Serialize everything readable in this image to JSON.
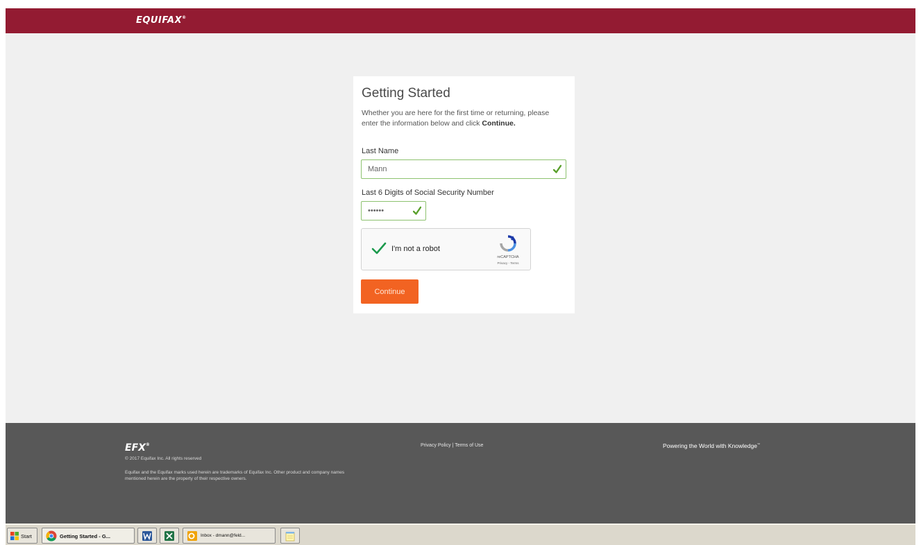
{
  "header": {
    "logo": "EQUIFAX",
    "logo_mark": "®"
  },
  "card": {
    "title": "Getting Started",
    "intro_text": "Whether you are here for the first time or returning, please enter the information below and click",
    "intro_bold": "Continue.",
    "last_name_label": "Last Name",
    "last_name_value": "Mann",
    "ssn_label": "Last 6 Digits of Social Security Number",
    "ssn_value": "••••••",
    "continue_label": "Continue"
  },
  "captcha": {
    "label": "I'm not a robot",
    "brand": "reCAPTCHA",
    "links": "Privacy - Terms"
  },
  "footer": {
    "logo": "EFX",
    "logo_mark": "®",
    "copyright": "© 2017 Equifax Inc. All rights reserved",
    "trademark": "Equifax and the Equifax marks used herein are trademarks of Equifax Inc. Other product and company names mentioned herein are the property of their respective owners.",
    "privacy_link": "Privacy Policy",
    "separator": "|",
    "terms_link": "Terms of Use",
    "tagline": "Powering the World with Knowledge",
    "tagline_mark": "™"
  },
  "taskbar": {
    "start_label": "Start",
    "chrome_label": "Getting Started - G...",
    "outlook_label": "Inbox - dmann@feld..."
  },
  "colors": {
    "brand_red": "#931b32",
    "accent_orange": "#f26322",
    "valid_green": "#8dc26f",
    "footer_gray": "#585858"
  },
  "icons": [
    "check-icon",
    "recaptcha-logo-icon",
    "chrome-icon",
    "word-icon",
    "excel-icon",
    "outlook-icon",
    "notepad-icon",
    "windows-flag-icon"
  ]
}
